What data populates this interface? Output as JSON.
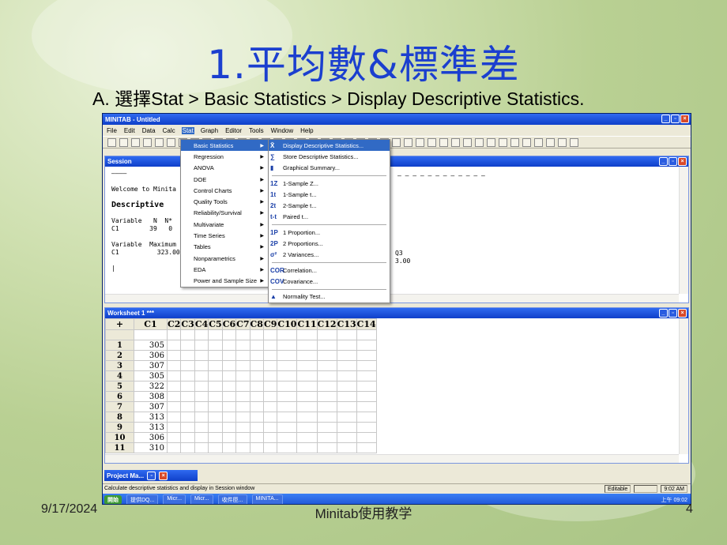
{
  "slide": {
    "title": "1.平均數&標準差",
    "subtitle": "A. 選擇Stat > Basic Statistics > Display Descriptive Statistics.",
    "date": "9/17/2024",
    "footer": "Minitab使用教学",
    "page": "4"
  },
  "app": {
    "title": "MINITAB - Untitled",
    "menus": [
      "File",
      "Edit",
      "Data",
      "Calc",
      "Stat",
      "Graph",
      "Editor",
      "Tools",
      "Window",
      "Help"
    ]
  },
  "session": {
    "title": "Session",
    "lines": [
      "————",
      "",
      "Welcome to Minita",
      "",
      "Descriptive",
      "",
      "Variable   N  N*",
      "C1        39   0",
      "",
      "Variable  Maximum",
      "C1          323.00",
      "",
      "|"
    ],
    "extra": "Q3",
    "extra2": "3.00"
  },
  "stat_menu": [
    "Basic Statistics",
    "Regression",
    "ANOVA",
    "DOE",
    "Control Charts",
    "Quality Tools",
    "Reliability/Survival",
    "Multivariate",
    "Time Series",
    "Tables",
    "Nonparametrics",
    "EDA",
    "Power and Sample Size"
  ],
  "basic_menu": [
    {
      "icon": "X̄",
      "label": "Display Descriptive Statistics..."
    },
    {
      "icon": "∑",
      "label": "Store Descriptive Statistics..."
    },
    {
      "icon": "▮",
      "label": "Graphical Summary..."
    },
    {
      "icon": "1Z",
      "label": "1-Sample Z..."
    },
    {
      "icon": "1t",
      "label": "1-Sample t..."
    },
    {
      "icon": "2t",
      "label": "2-Sample t..."
    },
    {
      "icon": "t-t",
      "label": "Paired t..."
    },
    {
      "icon": "1P",
      "label": "1 Proportion..."
    },
    {
      "icon": "2P",
      "label": "2 Proportions..."
    },
    {
      "icon": "σ²",
      "label": "2 Variances..."
    },
    {
      "icon": "COR",
      "label": "Correlation..."
    },
    {
      "icon": "COV",
      "label": "Covariance..."
    },
    {
      "icon": "▲",
      "label": "Normality Test..."
    }
  ],
  "worksheet": {
    "title": "Worksheet 1 ***",
    "columns": [
      "C1",
      "C2",
      "C3",
      "C4",
      "C5",
      "C6",
      "C7",
      "C8",
      "C9",
      "C10",
      "C11",
      "C12",
      "C13",
      "C14"
    ],
    "rows": [
      "1",
      "2",
      "3",
      "4",
      "5",
      "6",
      "7",
      "8",
      "9",
      "10",
      "11"
    ],
    "c1": [
      "305",
      "306",
      "307",
      "305",
      "322",
      "308",
      "307",
      "313",
      "313",
      "306",
      "310"
    ]
  },
  "project": {
    "title": "Project Ma..."
  },
  "status": {
    "text": "Calculate descriptive statistics and display in Session window",
    "mode": "Editable",
    "time": "9:02 AM"
  },
  "taskbar": {
    "start": "開始",
    "items": [
      "提供DQ...",
      "Micr...",
      "Micr...",
      "收件匣...",
      "MINITA..."
    ],
    "clock": "上午 09:02"
  }
}
